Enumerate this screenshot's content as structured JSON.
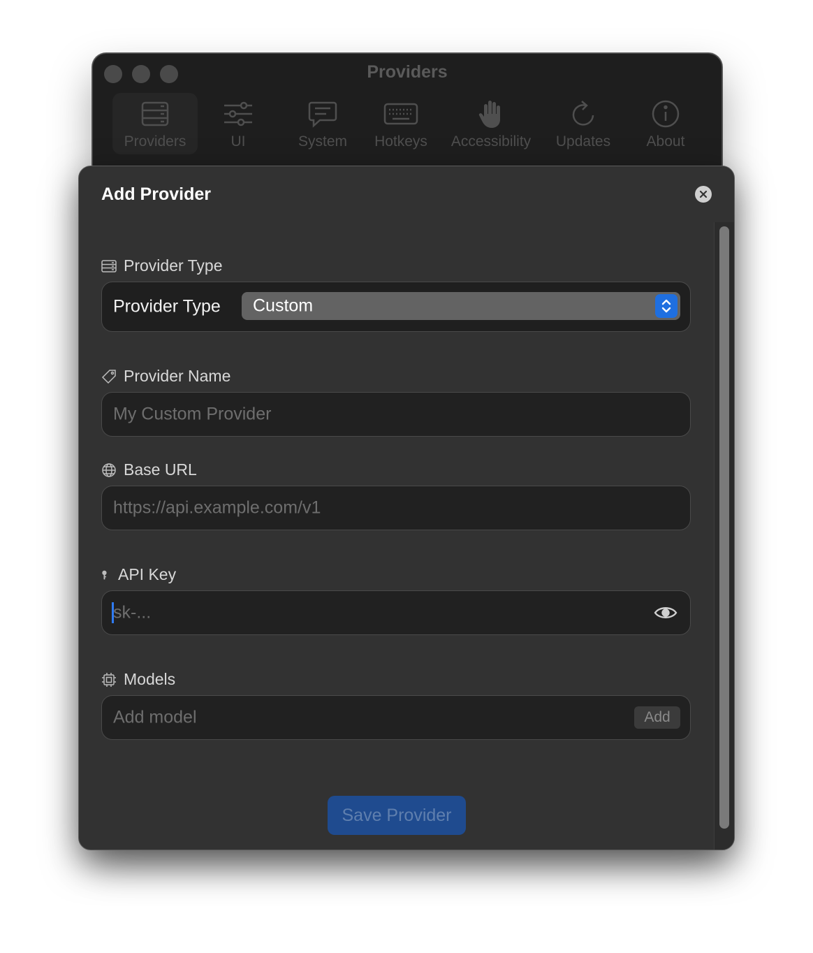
{
  "window": {
    "title": "Providers"
  },
  "toolbar": {
    "items": [
      {
        "label": "Providers",
        "icon": "server-icon"
      },
      {
        "label": "UI",
        "icon": "sliders-icon"
      },
      {
        "label": "System",
        "icon": "chat-bubble-icon"
      },
      {
        "label": "Hotkeys",
        "icon": "keyboard-icon"
      },
      {
        "label": "Accessibility",
        "icon": "hand-icon"
      },
      {
        "label": "Updates",
        "icon": "refresh-icon"
      },
      {
        "label": "About",
        "icon": "info-icon"
      }
    ],
    "selected": "Providers"
  },
  "sheet": {
    "title": "Add Provider",
    "provider_type": {
      "section_label": "Provider Type",
      "row_label": "Provider Type",
      "value": "Custom"
    },
    "provider_name": {
      "label": "Provider Name",
      "value": "",
      "placeholder": "My Custom Provider"
    },
    "base_url": {
      "label": "Base URL",
      "value": "",
      "placeholder": "https://api.example.com/v1"
    },
    "api_key": {
      "label": "API Key",
      "value": "",
      "placeholder": "sk-..."
    },
    "models": {
      "label": "Models",
      "placeholder": "Add model",
      "add_label": "Add"
    },
    "save_label": "Save Provider"
  },
  "colors": {
    "accent": "#1f6fe0",
    "sheet_bg": "#323232",
    "field_bg": "#212121"
  }
}
